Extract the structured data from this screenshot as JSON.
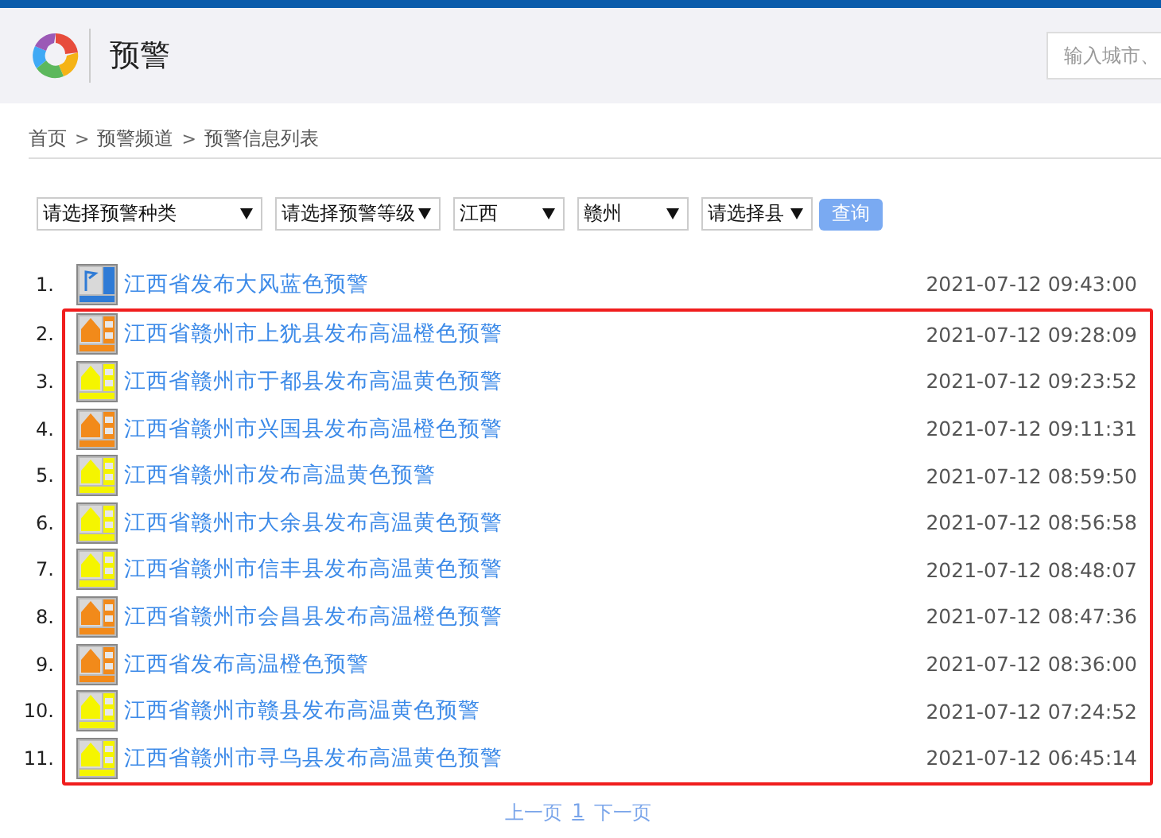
{
  "header": {
    "title": "预警",
    "search": {
      "placeholder": "输入城市、"
    }
  },
  "breadcrumb": [
    "首页",
    ">",
    "预警频道",
    ">",
    "预警信息列表"
  ],
  "filters": {
    "selects": [
      {
        "value": "请选择预警种类",
        "kind": "wide"
      },
      {
        "value": "请选择预警等级",
        "kind": "mid"
      },
      {
        "value": "江西",
        "kind": "narrow"
      },
      {
        "value": "赣州",
        "kind": "narrow"
      },
      {
        "value": "请选择县",
        "kind": "narrow"
      }
    ],
    "button": "查询"
  },
  "alerts": [
    {
      "number": "1.",
      "title": "江西省发布大风蓝色预警",
      "time": "2021-07-12 09:43:00",
      "kind": "wind",
      "color": "#2f7bd6",
      "highlighted": false
    },
    {
      "number": "2.",
      "title": "江西省赣州市上犹县发布高温橙色预警",
      "time": "2021-07-12 09:28:09",
      "kind": "heat",
      "color": "#f28a1a",
      "highlighted": true
    },
    {
      "number": "3.",
      "title": "江西省赣州市于都县发布高温黄色预警",
      "time": "2021-07-12 09:23:52",
      "kind": "heat",
      "color": "#f5f500",
      "highlighted": true
    },
    {
      "number": "4.",
      "title": "江西省赣州市兴国县发布高温橙色预警",
      "time": "2021-07-12 09:11:31",
      "kind": "heat",
      "color": "#f28a1a",
      "highlighted": true
    },
    {
      "number": "5.",
      "title": "江西省赣州市发布高温黄色预警",
      "time": "2021-07-12 08:59:50",
      "kind": "heat",
      "color": "#f5f500",
      "highlighted": true
    },
    {
      "number": "6.",
      "title": "江西省赣州市大余县发布高温黄色预警",
      "time": "2021-07-12 08:56:58",
      "kind": "heat",
      "color": "#f5f500",
      "highlighted": true
    },
    {
      "number": "7.",
      "title": "江西省赣州市信丰县发布高温黄色预警",
      "time": "2021-07-12 08:48:07",
      "kind": "heat",
      "color": "#f5f500",
      "highlighted": true
    },
    {
      "number": "8.",
      "title": "江西省赣州市会昌县发布高温橙色预警",
      "time": "2021-07-12 08:47:36",
      "kind": "heat",
      "color": "#f28a1a",
      "highlighted": true
    },
    {
      "number": "9.",
      "title": "江西省发布高温橙色预警",
      "time": "2021-07-12 08:36:00",
      "kind": "heat",
      "color": "#f28a1a",
      "highlighted": true
    },
    {
      "number": "10.",
      "title": "江西省赣州市赣县发布高温黄色预警",
      "time": "2021-07-12 07:24:52",
      "kind": "heat",
      "color": "#f5f500",
      "highlighted": true
    },
    {
      "number": "11.",
      "title": "江西省赣州市寻乌县发布高温黄色预警",
      "time": "2021-07-12 06:45:14",
      "kind": "heat",
      "color": "#f5f500",
      "highlighted": true
    }
  ],
  "pagination": [
    {
      "label": "上一页",
      "kind": "prev"
    },
    {
      "label": "1",
      "kind": "page"
    },
    {
      "label": "下一页",
      "kind": "next"
    }
  ]
}
